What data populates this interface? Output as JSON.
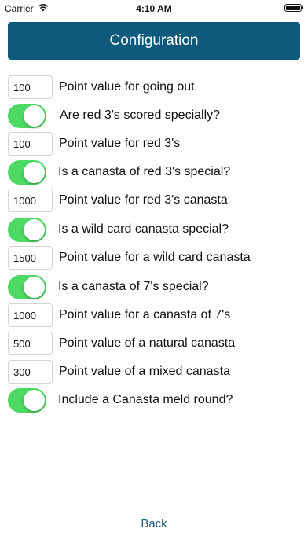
{
  "status_bar": {
    "carrier": "Carrier",
    "time": "4:10 AM"
  },
  "header": {
    "title": "Configuration"
  },
  "settings": {
    "going_out": {
      "value": "100",
      "label": "Point value for going out"
    },
    "red3_special": {
      "on": true,
      "label": "Are red 3's scored specially?"
    },
    "red3_value": {
      "value": "100",
      "label": "Point value for red 3's"
    },
    "red3_canasta_special": {
      "on": true,
      "label": "Is a canasta of red 3's special?"
    },
    "red3_canasta_value": {
      "value": "1000",
      "label": "Point value for red 3's canasta"
    },
    "wild_canasta_special": {
      "on": true,
      "label": "Is a wild card canasta special?"
    },
    "wild_canasta_value": {
      "value": "1500",
      "label": "Point value for a wild card canasta"
    },
    "sevens_canasta_special": {
      "on": true,
      "label": "Is a canasta of 7's special?"
    },
    "sevens_canasta_value": {
      "value": "1000",
      "label": "Point value for a canasta of 7's"
    },
    "natural_canasta_value": {
      "value": "500",
      "label": "Point value of a natural canasta"
    },
    "mixed_canasta_value": {
      "value": "300",
      "label": "Point value of a mixed canasta"
    },
    "meld_round": {
      "on": true,
      "label": "Include a Canasta meld round?"
    }
  },
  "footer": {
    "back_label": "Back"
  },
  "colors": {
    "header_bg": "#0f5a7c",
    "toggle_on": "#4cd964",
    "link": "#1d5e80"
  }
}
